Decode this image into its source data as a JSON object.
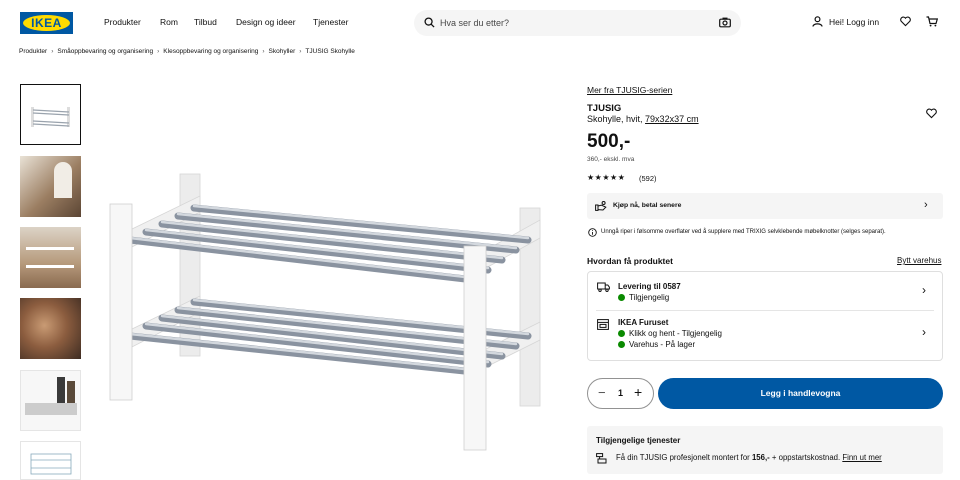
{
  "brand": {
    "logo_text": "IKEA",
    "primary": "#0058a3",
    "yellow": "#ffdb00",
    "available": "#0a8a00"
  },
  "nav": [
    "Produkter",
    "Rom",
    "Tilbud",
    "Design og ideer",
    "Tjenester"
  ],
  "search": {
    "placeholder": "Hva ser du etter?"
  },
  "header": {
    "login_label": "Hei! Logg inn"
  },
  "breadcrumb": [
    "Produkter",
    "Småoppbevaring og organisering",
    "Klesoppbevaring og organisering",
    "Skohyller",
    "TJUSIG Skohylle"
  ],
  "product": {
    "series_link": "Mer fra TJUSIG-serien",
    "name": "TJUSIG",
    "desc": "Skohylle, hvit,",
    "size": "79x32x37 cm",
    "price": "500,-",
    "price_ex_vat": "360,- ekskl. mva",
    "rating": 4.5,
    "review_count": "(592)"
  },
  "financing": {
    "label": "Kjøp nå, betal senere"
  },
  "notice": "Unngå riper i følsomme overflater ved å supplere med TRIXIG selvklebende møbelknotter (selges separat).",
  "delivery": {
    "heading": "Hvordan få produktet",
    "change_store": "Bytt varehus",
    "shipping_title": "Levering til 0587",
    "shipping_status": "Tilgjengelig",
    "store_title": "IKEA Furuset",
    "store_clickcollect": "Klikk og hent - Tilgjengelig",
    "store_stock": "Varehus - På lager"
  },
  "cart": {
    "quantity": "1",
    "minus": "−",
    "plus": "+",
    "add_label": "Legg i handlevogna"
  },
  "services": {
    "heading": "Tilgjengelige tjenester",
    "text_before": "Få din TJUSIG profesjonelt montert for",
    "price": "156,-",
    "text_after": "+ oppstartskostnad.",
    "link": "Finn ut mer"
  }
}
